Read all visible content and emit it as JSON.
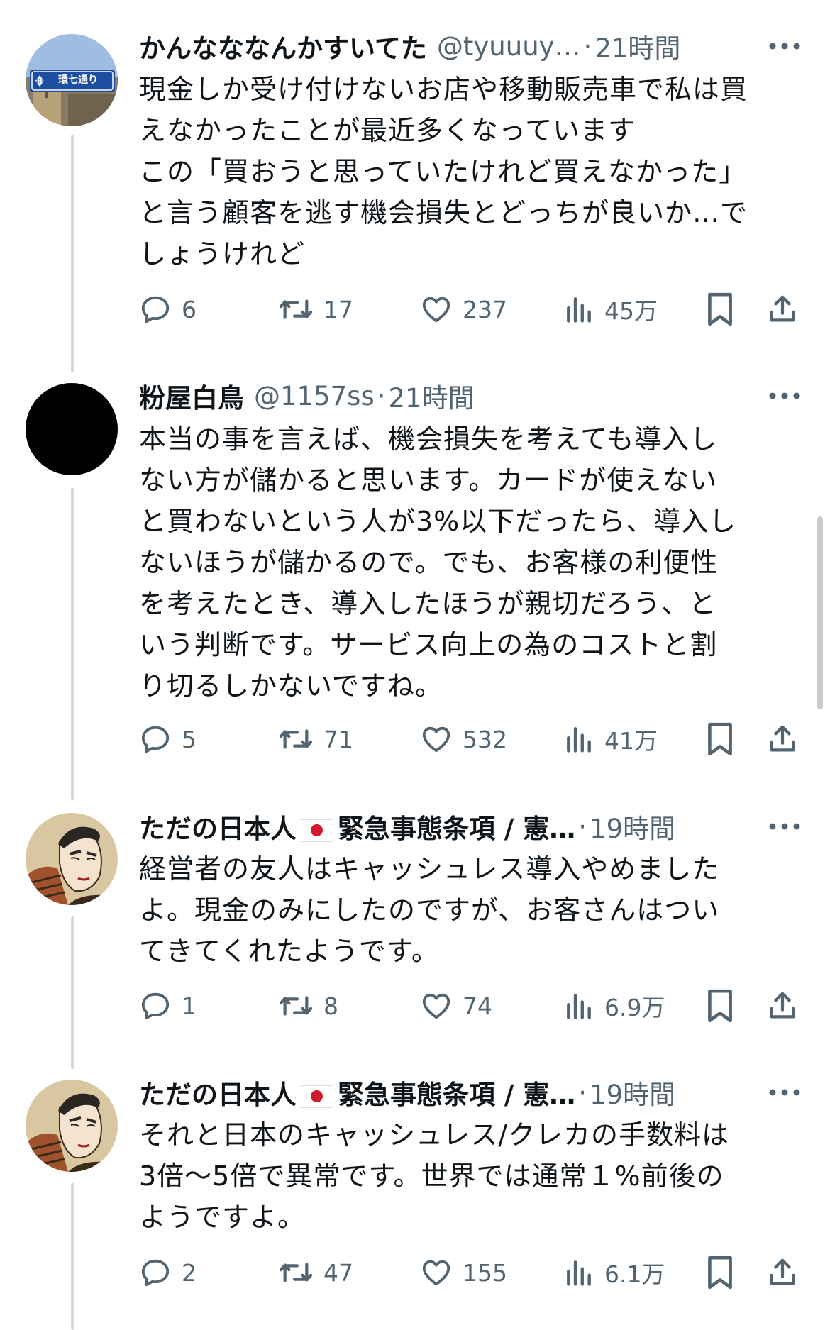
{
  "tweets": [
    {
      "name": "かんなななんかすいてた",
      "handle": "@tyuuuy…",
      "time": "21時間",
      "text": "現金しか受け付けないお店や移動販売車で私は買\nえなかったことが最近多くなっています\nこの「買おうと思っていたけれど買えなかった」\nと言う顧客を逃す機会損失とどっちが良いか…で\nしょうけれど",
      "replies": "6",
      "retweets": "17",
      "likes": "237",
      "views": "45万",
      "avatar_sign": "環七通り",
      "avatar_route": "318"
    },
    {
      "name": "粉屋白鳥",
      "handle": "@1157ss",
      "time": "21時間",
      "text": "本当の事を言えば、機会損失を考えても導入し\nない方が儲かると思います。カードが使えない\nと買わないという人が3%以下だったら、導入し\nないほうが儲かるので。でも、お客様の利便性\nを考えたとき、導入したほうが親切だろう、と\nいう判断です。サービス向上の為のコストと割\nり切るしかないですね。",
      "replies": "5",
      "retweets": "71",
      "likes": "532",
      "views": "41万"
    },
    {
      "name": "ただの日本人",
      "name_suffix": "緊急事態条項 / 憲…",
      "time": "19時間",
      "text": "経営者の友人はキャッシュレス導入やめました\nよ。現金のみにしたのですが、お客さんはつい\nてきてくれたようです。",
      "replies": "1",
      "retweets": "8",
      "likes": "74",
      "views": "6.9万"
    },
    {
      "name": "ただの日本人",
      "name_suffix": "緊急事態条項 / 憲…",
      "time": "19時間",
      "text": "それと日本のキャッシュレス/クレカの手数料は\n3倍〜5倍で異常です。世界では通常１%前後の\nようですよ。",
      "replies": "2",
      "retweets": "47",
      "likes": "155",
      "views": "6.1万"
    }
  ],
  "separator": "·",
  "icons": [
    "reply-icon",
    "retweet-icon",
    "like-icon",
    "views-icon",
    "bookmark-icon",
    "share-icon",
    "more-icon"
  ],
  "colors": {
    "text": "#0f1419",
    "muted": "#536471",
    "thread_line": "#cfd9de"
  }
}
